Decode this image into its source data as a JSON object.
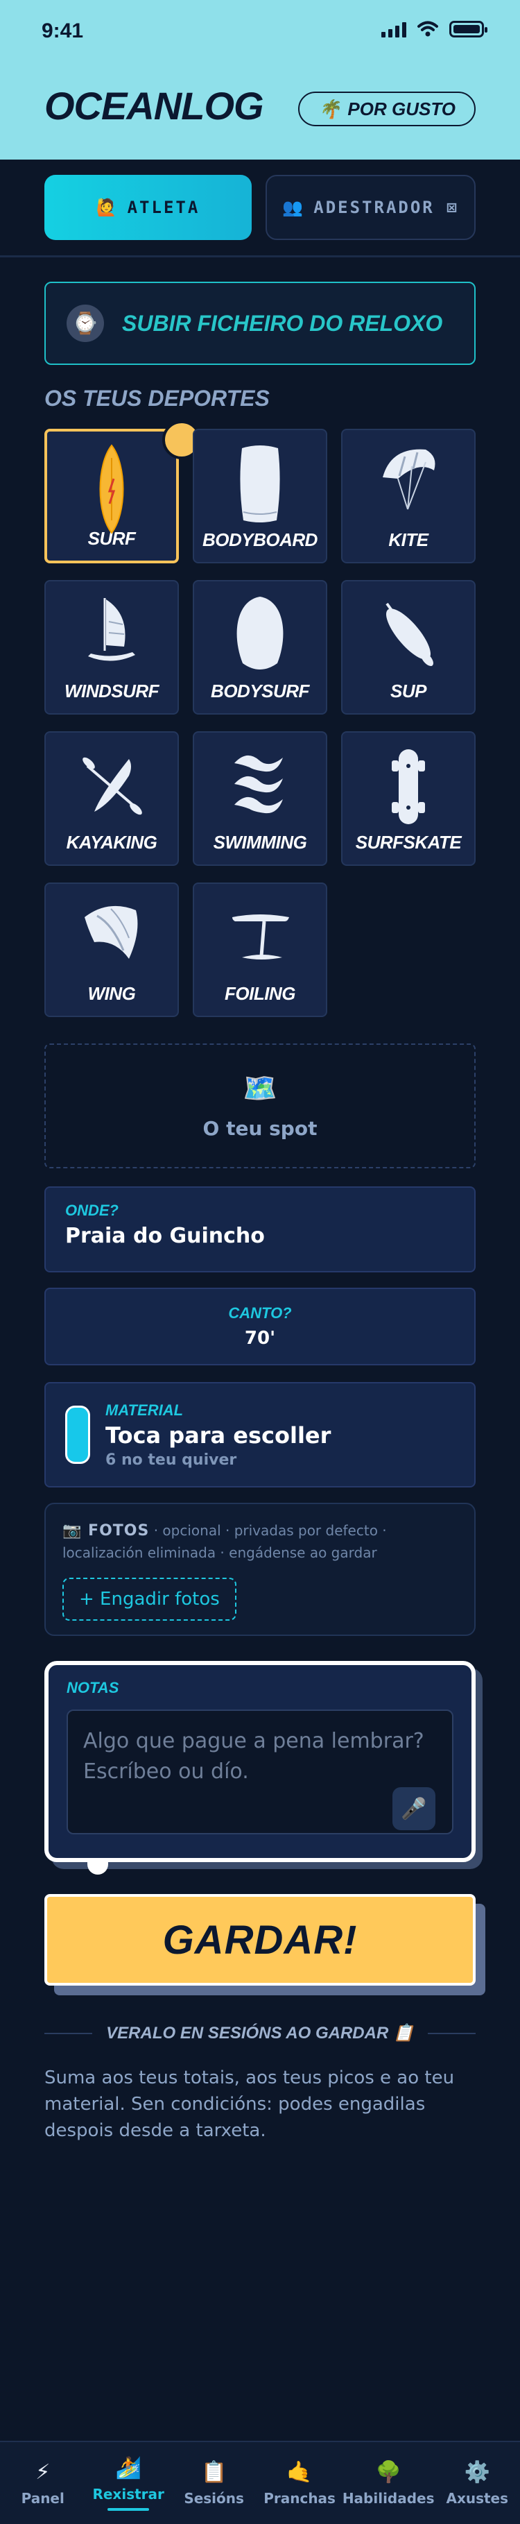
{
  "status_bar": {
    "time": "9:41"
  },
  "header": {
    "title": "OCEANLOG",
    "mood_icon": "🌴",
    "mood_label": "POR GUSTO"
  },
  "roles": [
    {
      "icon": "🙋",
      "label": "ATLETA",
      "active": true
    },
    {
      "icon": "👥",
      "label": "ADESTRADOR ⊠",
      "active": false
    }
  ],
  "upload": {
    "icon": "⌚",
    "label": "SUBIR FICHEIRO DO RELOXO"
  },
  "sports_title": "OS TEUS DEPORTES",
  "sports": [
    {
      "label": "SURF",
      "icon": "surfboard-icon",
      "selected": true
    },
    {
      "label": "BODYBOARD",
      "icon": "bodyboard-icon",
      "selected": false
    },
    {
      "label": "KITE",
      "icon": "kite-icon",
      "selected": false
    },
    {
      "label": "WINDSURF",
      "icon": "windsurf-icon",
      "selected": false
    },
    {
      "label": "BODYSURF",
      "icon": "handplane-icon",
      "selected": false
    },
    {
      "label": "SUP",
      "icon": "paddle-board-icon",
      "selected": false
    },
    {
      "label": "KAYAKING",
      "icon": "kayak-icon",
      "selected": false
    },
    {
      "label": "SWIMMING",
      "icon": "waves-icon",
      "selected": false
    },
    {
      "label": "SURFSKATE",
      "icon": "skateboard-icon",
      "selected": false
    },
    {
      "label": "WING",
      "icon": "wing-icon",
      "selected": false
    },
    {
      "label": "FOILING",
      "icon": "foil-icon",
      "selected": false
    }
  ],
  "spot": {
    "icon": "🗺️",
    "label": "O teu spot"
  },
  "where": {
    "label": "ONDE?",
    "value": "Praia do Guincho"
  },
  "angle": {
    "label": "CANTO?",
    "value": "70'"
  },
  "material": {
    "label": "MATERIAL",
    "value": "Toca para escoller",
    "sub": "6 no teu quiver"
  },
  "photos": {
    "title": "📷 FOTOS",
    "note": "· opcional · privadas por defecto · localización eliminada · engádense ao gardar",
    "button": "+ Engadir fotos"
  },
  "notes": {
    "label": "NOTAS",
    "placeholder": "Algo que pague a pena lembrar? Escríbeo ou dío.",
    "mic_icon": "🎤"
  },
  "save_label": "GARDAR!",
  "after_save": {
    "title": "VERALO EN SESIÓNS AO GARDAR 📋",
    "text": "Suma aos teus totais, aos teus picos e ao teu material. Sen condicións: podes engadilas despois desde a tarxeta."
  },
  "nav": [
    {
      "icon": "⚡",
      "label": "Panel",
      "active": false
    },
    {
      "icon": "🏄",
      "label": "Rexistrar",
      "active": true
    },
    {
      "icon": "📋",
      "label": "Sesións",
      "active": false
    },
    {
      "icon": "🤙",
      "label": "Pranchas",
      "active": false
    },
    {
      "icon": "🌳",
      "label": "Habilidades",
      "active": false
    },
    {
      "icon": "⚙️",
      "label": "Axustes",
      "active": false
    }
  ],
  "colors": {
    "accent": "#1ec8e0",
    "highlight": "#ffc95a",
    "header_bg": "#8fe0ea",
    "background": "#0c1628"
  }
}
